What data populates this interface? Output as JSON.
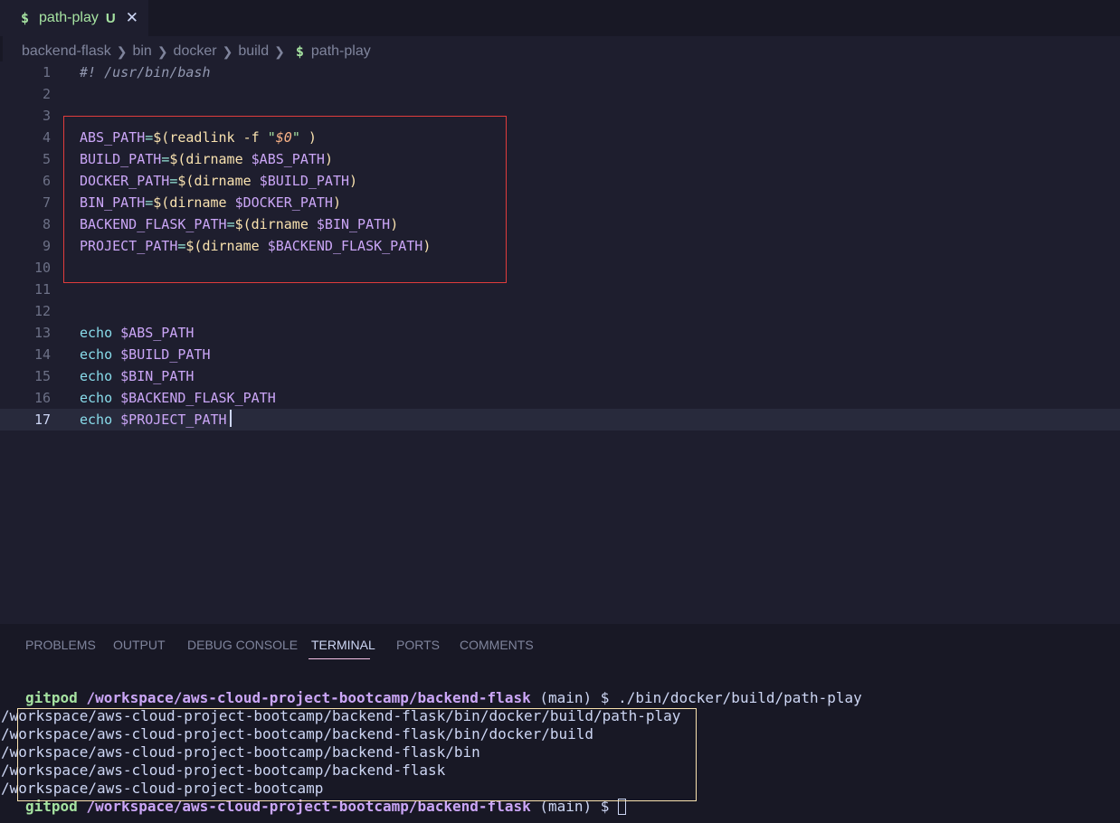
{
  "tab": {
    "icon": "dollar-sign-icon",
    "name": "path-play",
    "status": "U",
    "close": "✕"
  },
  "breadcrumb": {
    "items": [
      "backend-flask",
      "bin",
      "docker",
      "build"
    ],
    "file": "path-play"
  },
  "editor": {
    "line_numbers": [
      "1",
      "2",
      "3",
      "4",
      "5",
      "6",
      "7",
      "8",
      "9",
      "10",
      "11",
      "12",
      "13",
      "14",
      "15",
      "16",
      "17"
    ],
    "current_line": "17",
    "code": {
      "l1": "#! /usr/bin/bash",
      "l4_var": "ABS_PATH",
      "l4_cmd": "readlink -f ",
      "l4_arg": "$0",
      "l5_var": "BUILD_PATH",
      "l5_cmd": "dirname ",
      "l5_arg": "$ABS_PATH",
      "l6_var": "DOCKER_PATH",
      "l6_cmd": "dirname ",
      "l6_arg": "$BUILD_PATH",
      "l7_var": "BIN_PATH",
      "l7_cmd": "dirname ",
      "l7_arg": "$DOCKER_PATH",
      "l8_var": "BACKEND_FLASK_PATH",
      "l8_cmd": "dirname ",
      "l8_arg": "$BIN_PATH",
      "l9_var": "PROJECT_PATH",
      "l9_cmd": "dirname ",
      "l9_arg": "$BACKEND_FLASK_PATH",
      "echo": "echo",
      "l13_arg": "$ABS_PATH",
      "l14_arg": "$BUILD_PATH",
      "l15_arg": "$BIN_PATH",
      "l16_arg": "$BACKEND_FLASK_PATH",
      "l17_arg": "$PROJECT_PATH"
    }
  },
  "panel": {
    "tabs": [
      "PROBLEMS",
      "OUTPUT",
      "DEBUG CONSOLE",
      "TERMINAL",
      "PORTS",
      "COMMENTS"
    ],
    "active_tab": "TERMINAL"
  },
  "terminal": {
    "prompt_user": "gitpod",
    "prompt_path": "/workspace/aws-cloud-project-bootcamp/backend-flask",
    "branch": "(main)",
    "symbol": "$",
    "command": "./bin/docker/build/path-play",
    "output": [
      "/workspace/aws-cloud-project-bootcamp/backend-flask/bin/docker/build/path-play",
      "/workspace/aws-cloud-project-bootcamp/backend-flask/bin/docker/build",
      "/workspace/aws-cloud-project-bootcamp/backend-flask/bin",
      "/workspace/aws-cloud-project-bootcamp/backend-flask",
      "/workspace/aws-cloud-project-bootcamp"
    ]
  },
  "colors": {
    "background": "#1e1e2e",
    "highlight_red": "#e03c3c",
    "highlight_yellow": "#f9e2af",
    "accent_green": "#a6e3a1",
    "accent_purple": "#cba6f7"
  }
}
